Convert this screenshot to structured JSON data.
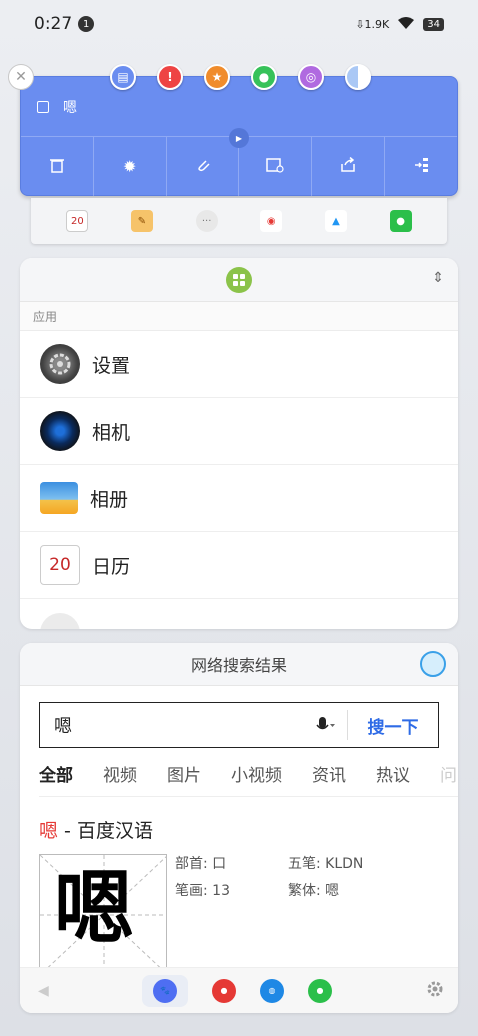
{
  "status": {
    "time": "0:27",
    "notif_count": "1",
    "net_speed": "1.9K",
    "battery": "34"
  },
  "note": {
    "text": "嗯",
    "colors": [
      "#6a8df0",
      "#ee4444",
      "#f08c2c",
      "#37c25a",
      "#b06ae0",
      "#aac8f5"
    ]
  },
  "apps": {
    "section_label": "应用",
    "items": [
      {
        "label": "设置",
        "icon": "settings-gear-icon"
      },
      {
        "label": "相机",
        "icon": "camera-lens-icon"
      },
      {
        "label": "相册",
        "icon": "gallery-photo-icon"
      },
      {
        "label": "日历",
        "icon": "calendar-icon",
        "day": "20"
      }
    ]
  },
  "search": {
    "header": "网络搜索结果",
    "query": "嗯",
    "button": "搜一下",
    "tabs": [
      "全部",
      "视频",
      "图片",
      "小视频",
      "资讯",
      "热议",
      "问"
    ],
    "result": {
      "highlight": "嗯",
      "title_rest": " - 百度汉语",
      "glyph": "嗯",
      "radical": "部首: 口",
      "strokes": "笔画: 13",
      "wubi": "五笔: KLDN",
      "traditional": "繁体: 嗯"
    }
  },
  "calendar_day": "20"
}
